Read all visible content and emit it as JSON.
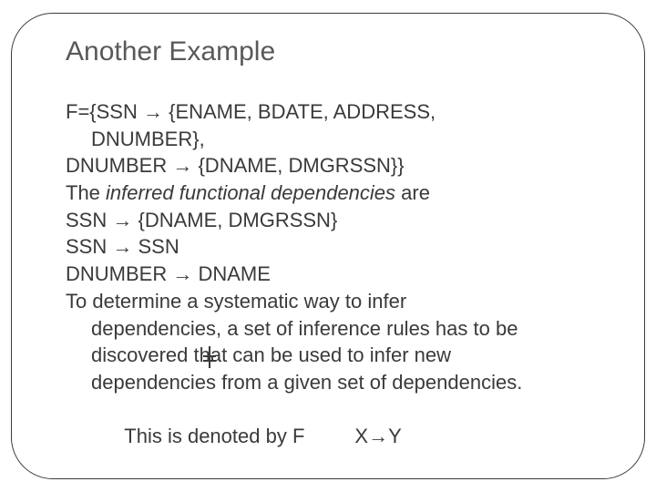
{
  "title": "Another Example",
  "lines": {
    "l1a": "F={SSN ",
    "arrow": "→",
    "l1b": " {ENAME, BDATE, ADDRESS,",
    "l2": "DNUMBER},",
    "l3a": "DNUMBER ",
    "l3b": " {DNAME, DMGRSSN}}",
    "l4a": "The ",
    "l4i": "inferred functional dependencies",
    "l4b": " are",
    "l5a": "SSN ",
    "l5b": " {DNAME, DMGRSSN}",
    "l6a": "SSN ",
    "l6b": " SSN",
    "l7a": "DNUMBER ",
    "l7b": " DNAME",
    "l8": "To determine a systematic way to infer",
    "l9": "dependencies, a set of inference rules has to be",
    "l10": "discovered that can be used to infer new",
    "l11": "dependencies from a given set of dependencies.",
    "l12a": "This is denoted by F         X",
    "l12b": "Y"
  }
}
